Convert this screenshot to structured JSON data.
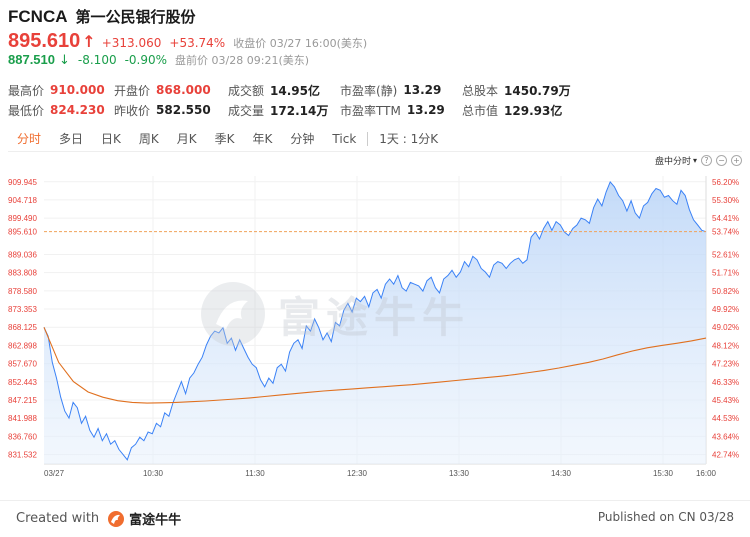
{
  "header": {
    "ticker": "FCNCA",
    "name": "第一公民银行股份",
    "price": "895.610",
    "change": "+313.060",
    "change_pct": "+53.74%",
    "close_meta": "收盘价 03/27 16:00(美东)",
    "pm_price": "887.510",
    "pm_change": "-8.100",
    "pm_change_pct": "-0.90%",
    "pm_meta": "盘前价 03/28 09:21(美东)"
  },
  "stats": [
    [
      {
        "label": "最高价",
        "value": "910.000",
        "color": "red"
      },
      {
        "label": "开盘价",
        "value": "868.000",
        "color": "red"
      },
      {
        "label": "成交额",
        "value": "14.95亿",
        "color": ""
      },
      {
        "label": "市盈率(静)",
        "value": "13.29",
        "color": ""
      },
      {
        "label": "总股本",
        "value": "1450.79万",
        "color": ""
      }
    ],
    [
      {
        "label": "最低价",
        "value": "824.230",
        "color": "red"
      },
      {
        "label": "昨收价",
        "value": "582.550",
        "color": ""
      },
      {
        "label": "成交量",
        "value": "172.14万",
        "color": ""
      },
      {
        "label": "市盈率TTM",
        "value": "13.29",
        "color": ""
      },
      {
        "label": "总市值",
        "value": "129.93亿",
        "color": ""
      }
    ]
  ],
  "tabs": [
    "分时",
    "多日",
    "日K",
    "周K",
    "月K",
    "季K",
    "年K",
    "分钟",
    "Tick"
  ],
  "tabs_extra": "1天 : 1分K",
  "chart_tools": {
    "label": "盘中分时",
    "icons": [
      "help-icon",
      "zoom-out-icon",
      "zoom-in-icon"
    ]
  },
  "watermark": "富途牛牛",
  "footer": {
    "created_with": "Created with",
    "brand": "富途牛牛",
    "published": "Published on CN 03/28"
  },
  "colors": {
    "up": "#e8413a",
    "down": "#1a9e4b",
    "accent": "#f06d2f",
    "price_line": "#3b82f6",
    "avg_line": "#e0701f"
  },
  "chart_data": {
    "type": "area",
    "y_left_ticks": [
      "909.945",
      "904.718",
      "899.490",
      "895.610",
      "889.036",
      "883.808",
      "878.580",
      "873.353",
      "868.125",
      "862.898",
      "857.670",
      "852.443",
      "847.215",
      "841.988",
      "836.760",
      "831.532"
    ],
    "y_right_ticks": [
      "56.20%",
      "55.30%",
      "54.41%",
      "53.74%",
      "52.61%",
      "51.71%",
      "50.82%",
      "49.92%",
      "49.02%",
      "48.12%",
      "47.23%",
      "46.33%",
      "45.43%",
      "44.53%",
      "43.64%",
      "42.74%"
    ],
    "x_ticks": [
      "03/27",
      "10:30",
      "11:30",
      "12:30",
      "13:30",
      "14:30",
      "15:30",
      "16:00"
    ],
    "reference_price": 895.61,
    "ylim": [
      828.8,
      911.6
    ],
    "series": [
      {
        "values": [
          868.1,
          865.5,
          858.0,
          853.5,
          848.0,
          844.0,
          842.0,
          846.5,
          845.0,
          840.5,
          842.5,
          838.5,
          836.5,
          839.0,
          835.5,
          837.5,
          834.5,
          835.5,
          833.0,
          831.5,
          830.0,
          833.5,
          834.5,
          836.5,
          835.5,
          838.0,
          837.5,
          840.5,
          839.5,
          843.5,
          842.5,
          846.5,
          849.5,
          852.5,
          849.0,
          853.5,
          855.0,
          857.5,
          859.5,
          863.0,
          865.5,
          867.0,
          866.5,
          868.0,
          863.5,
          865.0,
          861.5,
          864.5,
          862.0,
          859.5,
          857.5,
          856.5,
          853.0,
          851.0,
          853.5,
          852.0,
          856.5,
          857.5,
          855.5,
          861.0,
          863.5,
          864.5,
          862.0,
          868.5,
          867.0,
          870.5,
          868.0,
          864.5,
          866.5,
          864.0,
          869.5,
          868.5,
          873.0,
          875.0,
          872.5,
          876.5,
          875.5,
          877.0,
          874.0,
          878.0,
          879.0,
          876.5,
          880.5,
          882.0,
          880.5,
          883.0,
          879.5,
          878.5,
          881.0,
          880.5,
          880.0,
          878.5,
          881.5,
          882.5,
          879.5,
          878.0,
          882.0,
          883.0,
          884.5,
          882.5,
          884.0,
          887.0,
          885.5,
          888.5,
          887.5,
          885.0,
          884.0,
          882.5,
          886.0,
          887.0,
          886.5,
          885.0,
          886.5,
          887.5,
          888.0,
          886.5,
          887.5,
          894.0,
          895.5,
          893.5,
          896.5,
          898.5,
          896.0,
          898.5,
          897.5,
          895.5,
          894.5,
          896.5,
          897.5,
          899.5,
          899.0,
          898.0,
          902.5,
          905.0,
          903.0,
          907.0,
          909.9,
          908.5,
          906.0,
          904.5,
          901.5,
          904.5,
          901.0,
          899.5,
          903.0,
          904.0,
          906.5,
          908.0,
          907.5,
          905.5,
          906.0,
          904.5,
          903.5,
          907.5,
          906.0,
          902.0,
          899.0,
          897.5,
          896.0,
          895.6
        ]
      },
      {
        "values": [
          868.1,
          858.0,
          852.5,
          849.5,
          848.0,
          847.0,
          846.5,
          846.3,
          846.4,
          846.5,
          846.7,
          846.9,
          847.2,
          847.5,
          847.8,
          848.2,
          848.6,
          849.0,
          849.4,
          849.8,
          850.1,
          850.4,
          850.7,
          851.0,
          851.3,
          851.6,
          852.0,
          852.4,
          852.8,
          853.2,
          853.6,
          854.0,
          854.5,
          855.1,
          855.7,
          856.4,
          857.2,
          858.0,
          859.0,
          860.2,
          861.3,
          862.2,
          862.9,
          863.5,
          864.2,
          865.0
        ]
      }
    ]
  }
}
